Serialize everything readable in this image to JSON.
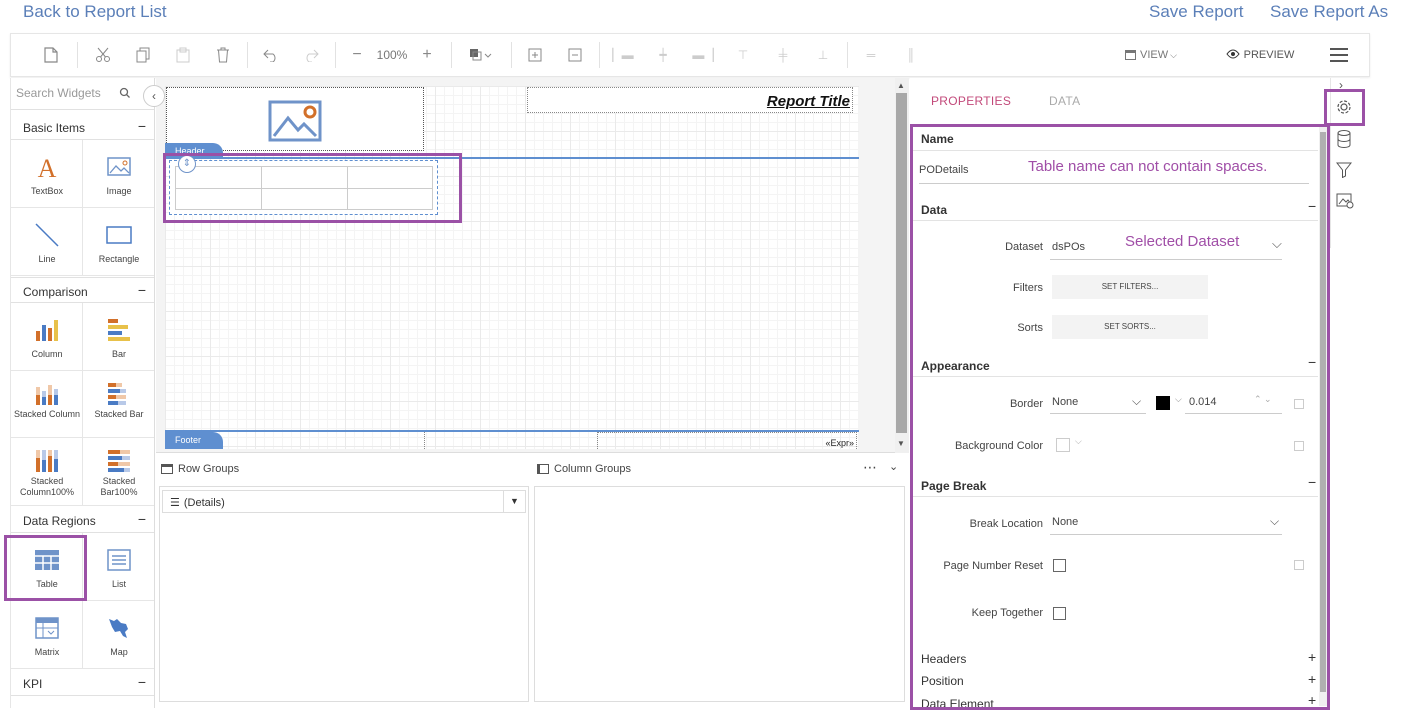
{
  "top_links": {
    "back": "Back to Report List",
    "save": "Save Report",
    "save_as": "Save Report As"
  },
  "toolbar": {
    "zoom": "100%",
    "view": "VIEW",
    "preview": "PREVIEW"
  },
  "widgets": {
    "search_placeholder": "Search Widgets",
    "sections": {
      "basic": "Basic Items",
      "comparison": "Comparison",
      "data_regions": "Data Regions",
      "kpi": "KPI"
    },
    "basic_items": [
      "TextBox",
      "Image",
      "Line",
      "Rectangle"
    ],
    "comparison_items": [
      "Column",
      "Bar",
      "Stacked Column",
      "Stacked Bar",
      "Stacked Column100%",
      "Stacked Bar100%"
    ],
    "data_region_items": [
      "Table",
      "List",
      "Matrix",
      "Map"
    ]
  },
  "canvas": {
    "report_title": "Report Title",
    "header": "Header",
    "footer": "Footer",
    "expr": "«Expr»"
  },
  "groups": {
    "row_groups": "Row Groups",
    "column_groups": "Column Groups",
    "details": "(Details)"
  },
  "properties": {
    "tab_properties": "PROPERTIES",
    "tab_data": "DATA",
    "name_header": "Name",
    "name_value": "PODetails",
    "name_note": "Table name can not contain spaces.",
    "data_header": "Data",
    "dataset_label": "Dataset",
    "dataset_value": "dsPOs",
    "dataset_note": "Selected Dataset",
    "filters_label": "Filters",
    "filters_button": "SET FILTERS...",
    "sorts_label": "Sorts",
    "sorts_button": "SET SORTS...",
    "appearance_header": "Appearance",
    "border_label": "Border",
    "border_style": "None",
    "border_width": "0.014",
    "bg_label": "Background Color",
    "pagebreak_header": "Page Break",
    "break_location_label": "Break Location",
    "break_location_value": "None",
    "page_number_reset_label": "Page Number Reset",
    "keep_together_label": "Keep Together",
    "headers": "Headers",
    "position": "Position",
    "data_element": "Data Element"
  },
  "colors": {
    "accent_purple": "#9b51a6",
    "band_blue": "#5f8fd0",
    "link_blue": "#5b7fb8",
    "tab_active": "#c2497a"
  }
}
